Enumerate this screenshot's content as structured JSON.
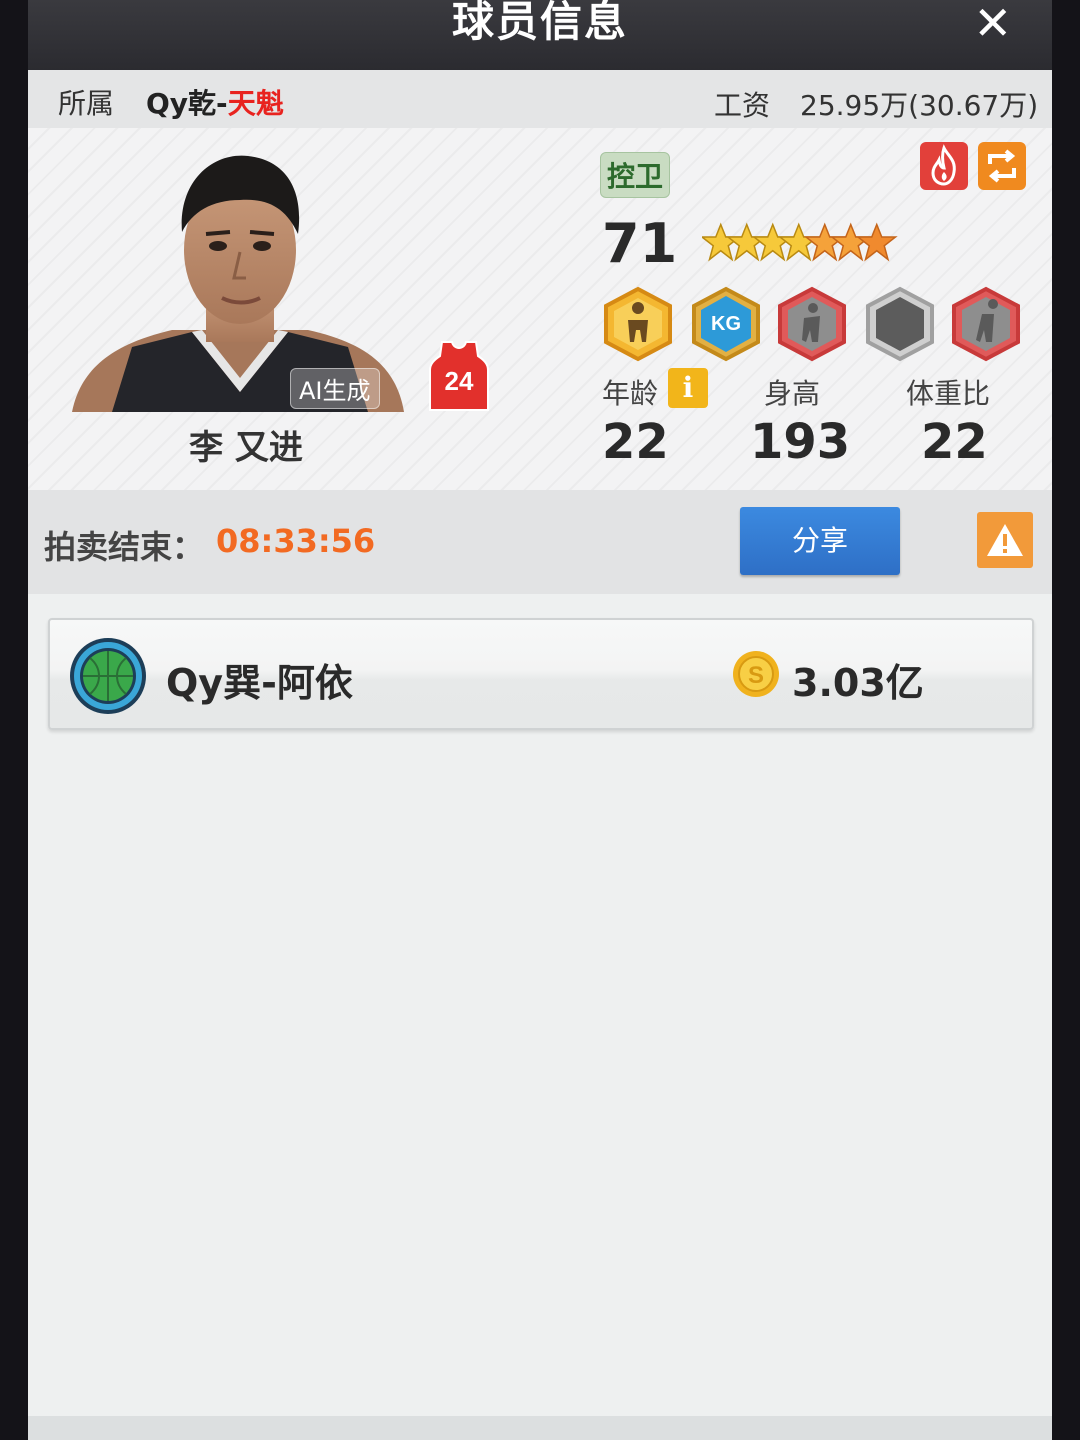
{
  "dialog": {
    "title": "球员信息",
    "close_symbol": "✕"
  },
  "info": {
    "affiliation_label": "所属",
    "team_prefix": "Qy乾-",
    "team_suffix": "天魁",
    "salary_label": "工资",
    "salary_value": "25.95万(30.67万)"
  },
  "player": {
    "ai_tag": "AI生成",
    "jersey_number": "24",
    "name": "李 又进",
    "position": "控卫",
    "rating": "71",
    "stars": {
      "gold": 4,
      "orange": 3,
      "total": 7
    },
    "badges": [
      "silhouette-gold-badge",
      "kg-blue-badge",
      "shooter-red-badge",
      "empty-gray-badge",
      "layup-red-badge"
    ],
    "stats": {
      "age_label": "年龄",
      "age_value": "22",
      "age_info_symbol": "i",
      "height_label": "身高",
      "height_value": "193",
      "weight_ratio_label": "体重比",
      "weight_ratio_value": "22"
    }
  },
  "auction": {
    "end_label": "拍卖结束：",
    "countdown": "08:33:56",
    "share_label": "分享"
  },
  "bids": [
    {
      "team": "Qy巽-阿依",
      "amount": "3.03亿"
    }
  ],
  "colors": {
    "accent_red": "#e8231f",
    "countdown_orange": "#f26a22",
    "share_blue": "#2e6fc6",
    "warning_orange": "#f29a3a"
  }
}
